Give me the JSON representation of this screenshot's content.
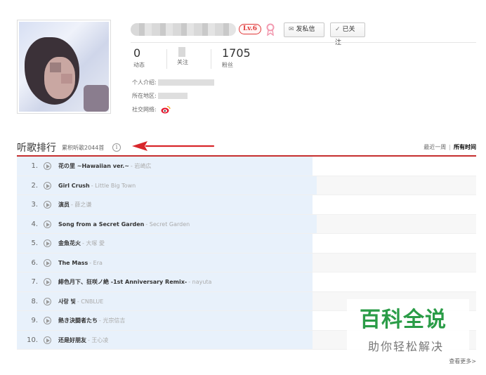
{
  "profile": {
    "level": "Lv.6",
    "message_button": "发私信",
    "follow_button": "已关注",
    "stats": {
      "events_count": "0",
      "events_label": "动态",
      "following_label": "关注",
      "fans_count": "1705",
      "fans_label": "粉丝"
    },
    "intro_label": "个人介绍:",
    "region_label": "所在地区:",
    "social_label": "社交网络:"
  },
  "ranking": {
    "title": "听歌排行",
    "total": "累积听歌2044首",
    "info_icon": "i",
    "period_week": "最近一周",
    "period_separator": "|",
    "period_all": "所有时间",
    "more_link": "查看更多>",
    "songs": [
      {
        "rank": "1.",
        "title": "花の里 ~Hawaiian ver.~",
        "artist": "- 岩崎広",
        "progress": 0.643
      },
      {
        "rank": "2.",
        "title": "Girl Crush",
        "artist": "- Little Big Town",
        "progress": 0.653
      },
      {
        "rank": "3.",
        "title": "演员",
        "artist": "- 薛之谦",
        "progress": 0.643
      },
      {
        "rank": "4.",
        "title": "Song from a Secret Garden",
        "artist": "- Secret Garden",
        "progress": 0.653
      },
      {
        "rank": "5.",
        "title": "金魚花火",
        "artist": "- 大塚 愛",
        "progress": 0.643
      },
      {
        "rank": "6.",
        "title": "The Mass",
        "artist": "- Era",
        "progress": 0.643
      },
      {
        "rank": "7.",
        "title": "緋色月下、狂咲ノ絶 -1st Anniversary Remix-",
        "artist": "- nayuta",
        "progress": 0.643
      },
      {
        "rank": "8.",
        "title": "사랑 빛",
        "artist": "- CNBLUE",
        "progress": 0.643
      },
      {
        "rank": "9.",
        "title": "熱き決闘者たち",
        "artist": "- 光宗信吉",
        "progress": 0.643
      },
      {
        "rank": "10.",
        "title": "还是好朋友",
        "artist": "- 王心凌",
        "progress": 0.643
      }
    ]
  },
  "watermark": {
    "title": "百科全说",
    "subtitle": "助你轻松解决"
  },
  "colors": {
    "accent_red": "#c62f2f",
    "row_highlight": "#e8f1fb",
    "watermark_green": "#2a9c47"
  }
}
